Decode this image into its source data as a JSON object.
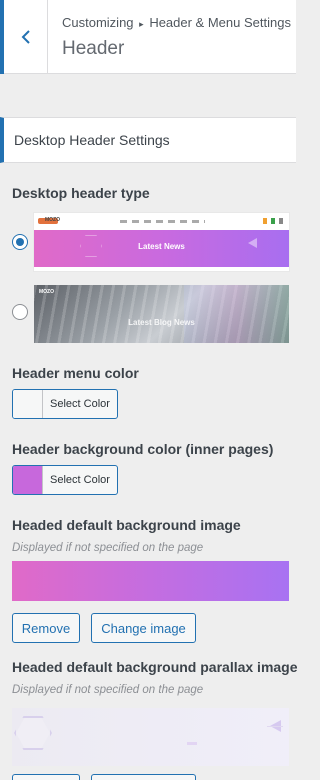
{
  "header": {
    "breadcrumb_root": "Customizing",
    "breadcrumb_sep": "▸",
    "breadcrumb_leaf": "Header & Menu Settings",
    "title": "Header"
  },
  "section": {
    "title": "Desktop Header Settings"
  },
  "header_type": {
    "label": "Desktop header type",
    "options": [
      {
        "selected": true,
        "preview_logo": "MOZO",
        "preview_title": "Latest News"
      },
      {
        "selected": false,
        "preview_logo": "MOZO",
        "preview_title": "Latest Blog News"
      }
    ]
  },
  "menu_color": {
    "label": "Header menu color",
    "button": "Select Color",
    "swatch": "#f6f7f7"
  },
  "bg_color": {
    "label": "Header background color (inner pages)",
    "button": "Select Color",
    "swatch": "#c768dc"
  },
  "bg_image": {
    "label": "Headed default background image",
    "desc": "Displayed if not specified on the page",
    "remove": "Remove",
    "change": "Change image"
  },
  "parallax": {
    "label": "Headed default background parallax image",
    "desc": "Displayed if not specified on the page"
  },
  "colors": {
    "accent": "#2271b1",
    "gradient_start": "#e06ac8",
    "gradient_end": "#a872f2"
  }
}
